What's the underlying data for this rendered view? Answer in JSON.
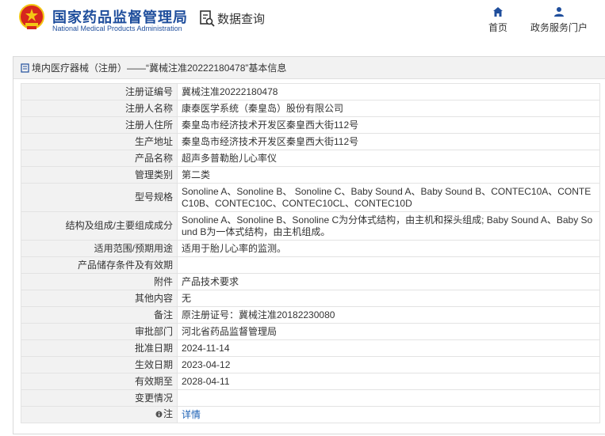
{
  "header": {
    "site_title_cn": "国家药品监督管理局",
    "site_title_en": "National Medical Products Administration",
    "query_label": "数据查询",
    "nav": [
      {
        "icon": "home-icon",
        "label": "首页"
      },
      {
        "icon": "user-icon",
        "label": "政务服务门户"
      }
    ]
  },
  "breadcrumb": "境内医疗器械（注册）——“冀械注准20222180478”基本信息",
  "rows": [
    {
      "label": "注册证编号",
      "value": "冀械注准20222180478"
    },
    {
      "label": "注册人名称",
      "value": "康泰医学系统（秦皇岛）股份有限公司"
    },
    {
      "label": "注册人住所",
      "value": "秦皇岛市经济技术开发区秦皇西大街112号"
    },
    {
      "label": "生产地址",
      "value": "秦皇岛市经济技术开发区秦皇西大街112号"
    },
    {
      "label": "产品名称",
      "value": "超声多普勒胎儿心率仪"
    },
    {
      "label": "管理类别",
      "value": "第二类"
    },
    {
      "label": "型号规格",
      "value": "Sonoline A、Sonoline B、 Sonoline C、Baby Sound A、Baby Sound B、CONTEC10A、CONTEC10B、CONTEC10C、CONTEC10CL、CONTEC10D"
    },
    {
      "label": "结构及组成/主要组成成分",
      "value": "Sonoline A、Sonoline B、Sonoline C为分体式结构，由主机和探头组成; Baby Sound A、Baby Sound B为一体式结构，由主机组成。"
    },
    {
      "label": "适用范围/预期用途",
      "value": "适用于胎儿心率的监测。"
    },
    {
      "label": "产品储存条件及有效期",
      "value": ""
    },
    {
      "label": "附件",
      "value": "产品技术要求"
    },
    {
      "label": "其他内容",
      "value": "无"
    },
    {
      "label": "备注",
      "value": "原注册证号：冀械注准20182230080"
    },
    {
      "label": "审批部门",
      "value": "河北省药品监督管理局"
    },
    {
      "label": "批准日期",
      "value": "2024-11-14"
    },
    {
      "label": "生效日期",
      "value": "2023-04-12"
    },
    {
      "label": "有效期至",
      "value": "2028-04-11"
    },
    {
      "label": "变更情况",
      "value": ""
    }
  ],
  "note": {
    "label": "注",
    "link": "详情"
  },
  "colors": {
    "brand_blue": "#1f4e9c",
    "link_blue": "#1a5fb4",
    "label_bg": "#f2f2f2",
    "emblem_red": "#d7261e",
    "emblem_gold": "#f3c614"
  }
}
